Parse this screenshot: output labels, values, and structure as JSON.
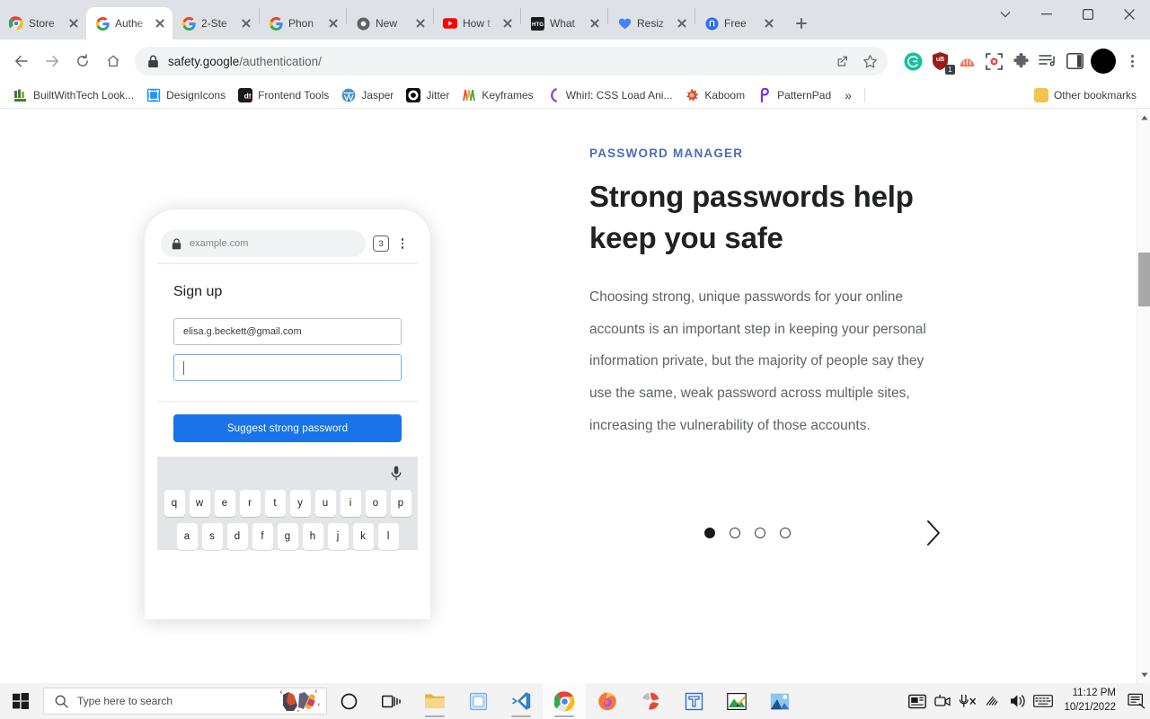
{
  "browser": {
    "tabs": [
      {
        "title": "Store",
        "icon": "chrome-store-icon",
        "active": false
      },
      {
        "title": "Authe",
        "icon": "google-icon",
        "active": true
      },
      {
        "title": "2-Ste",
        "icon": "google-icon",
        "active": false
      },
      {
        "title": "Phon",
        "icon": "google-icon",
        "active": false
      },
      {
        "title": "New",
        "icon": "chromium-icon",
        "active": false
      },
      {
        "title": "How t",
        "icon": "youtube-icon",
        "active": false
      },
      {
        "title": "What",
        "icon": "htg-icon",
        "active": false
      },
      {
        "title": "Resiz",
        "icon": "heart-icon",
        "active": false
      },
      {
        "title": "Free ",
        "icon": "invision-icon",
        "active": false
      }
    ],
    "new_tab_label": "New Tab",
    "window_controls": {
      "tab_search": "Search tabs",
      "minimize": "Minimize",
      "maximize": "Maximize",
      "close": "Close"
    },
    "toolbar": {
      "back": "Back",
      "forward": "Forward",
      "reload": "Reload",
      "home": "Home",
      "url_host": "safety.google",
      "url_path": "/authentication/",
      "share": "Share this page",
      "bookmark": "Bookmark this tab",
      "extensions": [
        {
          "name": "grammarly-icon",
          "label": "Grammarly"
        },
        {
          "name": "shield-extension-icon",
          "label": "uBlock",
          "badge": "1"
        },
        {
          "name": "honey-icon",
          "label": "Honey"
        },
        {
          "name": "screenshot-icon",
          "label": "Screen capture"
        },
        {
          "name": "puzzle-icon",
          "label": "Extensions"
        },
        {
          "name": "media-list-icon",
          "label": "Media controls"
        },
        {
          "name": "side-panel-icon",
          "label": "Side panel"
        }
      ],
      "profile": "Profile",
      "menu": "Customize and control Google Chrome"
    },
    "bookmarks": [
      {
        "label": "BuiltWithTech Look...",
        "icon": "bwt-icon",
        "color": "#4a7a2a"
      },
      {
        "label": "DesignIcons",
        "icon": "designicons-icon",
        "color": "#2196f3"
      },
      {
        "label": "Frontend Tools",
        "icon": "dt-icon",
        "color": "#1a1a1a"
      },
      {
        "label": "Jasper",
        "icon": "wordpress-icon",
        "color": "#4a90c4"
      },
      {
        "label": "Jitter",
        "icon": "jitter-icon",
        "color": "#000000"
      },
      {
        "label": "Keyframes",
        "icon": "keyframes-icon",
        "color": "#e54b4b"
      },
      {
        "label": "Whirl: CSS Load Ani...",
        "icon": "whirl-icon",
        "color": "#8a5cd1"
      },
      {
        "label": "Kaboom",
        "icon": "kaboom-icon",
        "color": "#d94a4a"
      },
      {
        "label": "PatternPad",
        "icon": "patternpad-icon",
        "color": "#7b2ff7"
      }
    ],
    "bookmarks_overflow": "»",
    "other_bookmarks": {
      "label": "Other bookmarks",
      "icon": "folder-icon"
    }
  },
  "page": {
    "phone": {
      "url": "example.com",
      "lock": "lock-icon",
      "tab_count": "3",
      "menu": "more-options-icon",
      "heading": "Sign up",
      "email_value": "elisa.g.beckett@gmail.com",
      "password_value": "",
      "suggest_button": "Suggest strong password",
      "suggest_button_color": "#1a73e8",
      "mic": "microphone-icon",
      "keyboard_row1": [
        "q",
        "w",
        "e",
        "r",
        "t",
        "y",
        "u",
        "i",
        "o",
        "p"
      ],
      "keyboard_row2": [
        "a",
        "s",
        "d",
        "f",
        "g",
        "h",
        "j",
        "k",
        "l"
      ]
    },
    "content": {
      "eyebrow": "PASSWORD MANAGER",
      "eyebrow_color": "#4b6cb7",
      "headline": "Strong passwords help keep you safe",
      "body": "Choosing strong, unique passwords for your online accounts is an important step in keeping your personal information private, but the majority of people say they use the same, weak password across multiple sites, increasing the vulnerability of those accounts.",
      "carousel": {
        "total": 4,
        "active_index": 0,
        "next_label": "Next"
      }
    }
  },
  "taskbar": {
    "start": "Start",
    "search_placeholder": "Type here to search",
    "search_icon": "search-icon",
    "cortana_art": "paint-art-icon",
    "items": [
      {
        "name": "cortana-icon",
        "running": false
      },
      {
        "name": "task-view-icon",
        "running": false
      },
      {
        "name": "file-explorer-icon",
        "running": true
      },
      {
        "name": "sticky-notes-icon",
        "running": false
      },
      {
        "name": "vscode-icon",
        "running": true
      },
      {
        "name": "chrome-icon",
        "running": true,
        "active": true
      },
      {
        "name": "firefox-icon",
        "running": false
      },
      {
        "name": "clipchamp-icon",
        "running": false
      },
      {
        "name": "blueprint-app-icon",
        "running": false
      },
      {
        "name": "paint-icon",
        "running": false
      },
      {
        "name": "photos-icon",
        "running": false
      }
    ],
    "tray": [
      {
        "name": "news-weather-icon"
      },
      {
        "name": "meet-camera-icon"
      },
      {
        "name": "mic-muted-icon"
      },
      {
        "name": "wifi-icon"
      },
      {
        "name": "volume-icon"
      },
      {
        "name": "keyboard-icon"
      }
    ],
    "time": "11:12 PM",
    "date": "10/21/2022",
    "action_center": "notifications-icon"
  }
}
